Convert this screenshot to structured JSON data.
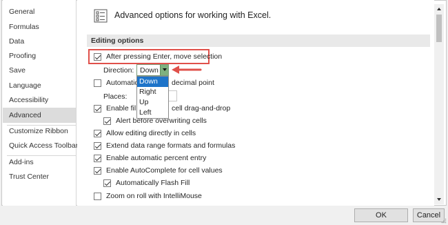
{
  "sidebar": {
    "items": [
      {
        "label": "General"
      },
      {
        "label": "Formulas"
      },
      {
        "label": "Data"
      },
      {
        "label": "Proofing"
      },
      {
        "label": "Save"
      },
      {
        "label": "Language"
      },
      {
        "label": "Accessibility"
      },
      {
        "label": "Advanced"
      },
      {
        "label": "Customize Ribbon"
      },
      {
        "label": "Quick Access Toolbar"
      },
      {
        "label": "Add-ins"
      },
      {
        "label": "Trust Center"
      }
    ],
    "active": "Advanced"
  },
  "header": {
    "title": "Advanced options for working with Excel."
  },
  "section": {
    "title": "Editing options"
  },
  "options": {
    "after_enter": {
      "label": "After pressing Enter, move selection",
      "checked": true
    },
    "direction": {
      "label": "Direction:",
      "value": "Down",
      "options": [
        "Down",
        "Right",
        "Up",
        "Left"
      ]
    },
    "auto_decimal": {
      "label_a": "Automatica",
      "label_b": "decimal point",
      "checked": false
    },
    "places": {
      "label": "Places:"
    },
    "fill_handle": {
      "label_a": "Enable fill h",
      "label_b": "cell drag-and-drop",
      "checked": true
    },
    "alert_overwrite": {
      "label": "Alert before overwriting cells",
      "checked": true
    },
    "edit_in_cells": {
      "label": "Allow editing directly in cells",
      "checked": true
    },
    "extend_formats": {
      "label": "Extend data range formats and formulas",
      "checked": true
    },
    "auto_percent": {
      "label": "Enable automatic percent entry",
      "checked": true
    },
    "autocomplete": {
      "label": "Enable AutoComplete for cell values",
      "checked": true
    },
    "flash_fill": {
      "label": "Automatically Flash Fill",
      "checked": true
    },
    "zoom_intellimouse": {
      "label": "Zoom on roll with IntelliMouse",
      "checked": false
    }
  },
  "footer": {
    "ok_label": "OK",
    "cancel_label": "Cancel"
  },
  "colors": {
    "highlight": "#e0504a",
    "selection": "#1e74c9",
    "active_nav": "#dcdcdc"
  }
}
